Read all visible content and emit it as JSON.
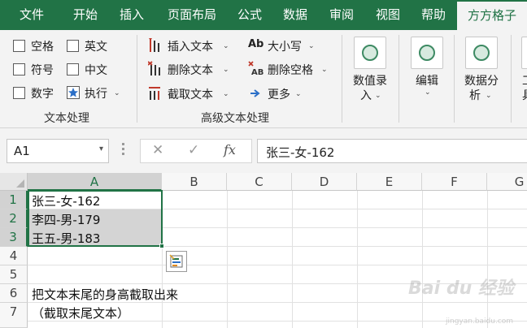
{
  "menu": {
    "tabs": [
      {
        "label": "文件"
      },
      {
        "label": "开始"
      },
      {
        "label": "插入"
      },
      {
        "label": "页面布局"
      },
      {
        "label": "公式"
      },
      {
        "label": "数据"
      },
      {
        "label": "审阅"
      },
      {
        "label": "视图"
      },
      {
        "label": "帮助"
      },
      {
        "label": "方方格子",
        "active": true
      }
    ]
  },
  "ribbon": {
    "text_group": {
      "label": "文本处理",
      "options": [
        "空格",
        "英文",
        "符号",
        "中文",
        "数字"
      ],
      "exec_label": "执行"
    },
    "advanced_group": {
      "label": "高级文本处理",
      "insert_text": "插入文本",
      "delete_text": "删除文本",
      "cut_text": "截取文本",
      "case_label": "大小写",
      "case_icon_text": "Ab",
      "delete_space": "删除空格",
      "more": "更多"
    },
    "big_buttons": [
      {
        "line1": "数值录",
        "line2": "入"
      },
      {
        "line1": "编辑",
        "line2": ""
      },
      {
        "line1": "数据分",
        "line2": "析"
      },
      {
        "line1": "工",
        "line2": "具"
      }
    ]
  },
  "formula_bar": {
    "name_box": "A1",
    "cancel_symbol": "✕",
    "confirm_symbol": "✓",
    "fx_symbol": "fx",
    "formula_value": "张三-女-162"
  },
  "sheet": {
    "columns": [
      "A",
      "B",
      "C",
      "D",
      "E",
      "F",
      "G"
    ],
    "rows": [
      "1",
      "2",
      "3",
      "4",
      "5",
      "6",
      "7"
    ],
    "cells": {
      "A1": "张三-女-162",
      "A2": "李四-男-179",
      "A3": "王五-男-183",
      "A6": "把文本末尾的身高截取出来",
      "A7": "（截取末尾文本）"
    }
  },
  "watermark": {
    "text": "Bai du 经验",
    "sub": "jingyan.baidu.com"
  }
}
